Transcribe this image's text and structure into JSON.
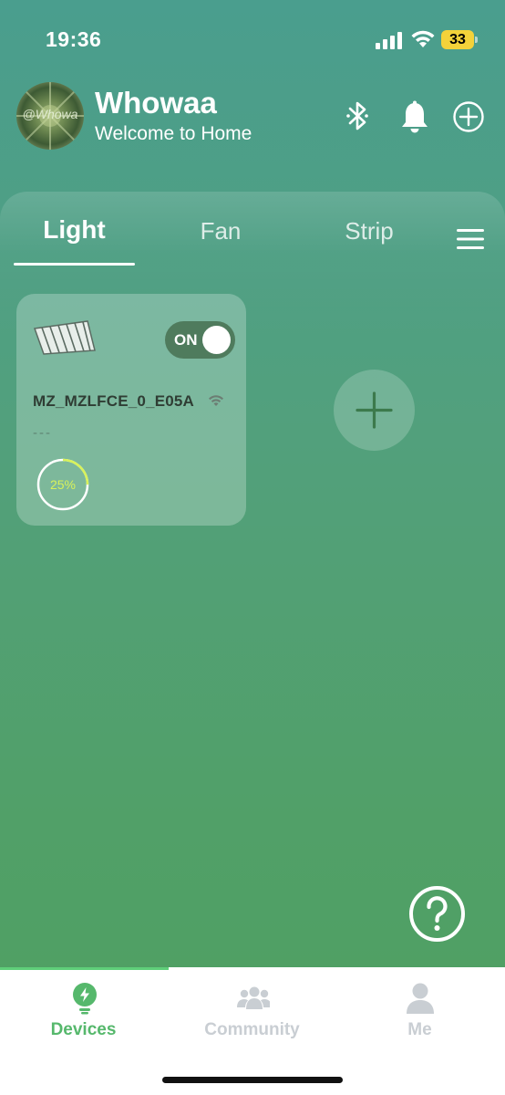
{
  "status_bar": {
    "time": "19:36",
    "battery": "33"
  },
  "header": {
    "avatar_text": "@Whowa",
    "title": "Whowaa",
    "subtitle": "Welcome to Home"
  },
  "tabs": [
    {
      "label": "Light",
      "active": true
    },
    {
      "label": "Fan",
      "active": false
    },
    {
      "label": "Strip",
      "active": false
    }
  ],
  "device": {
    "name": "MZ_MZLFCE_0_E05A",
    "toggle_label": "ON",
    "toggle_state": "on",
    "status_text": "---",
    "brightness_text": "25%",
    "brightness": 0.25
  },
  "colors": {
    "accent": "#56b86c",
    "toggle_bg": "#4f7b5d",
    "brightness_ring": "#d8f25a",
    "battery": "#f3d23a"
  },
  "tabbar": {
    "items": [
      {
        "label": "Devices",
        "icon": "lightbulb-bolt-icon",
        "active": true
      },
      {
        "label": "Community",
        "icon": "people-icon",
        "active": false
      },
      {
        "label": "Me",
        "icon": "person-icon",
        "active": false
      }
    ]
  }
}
